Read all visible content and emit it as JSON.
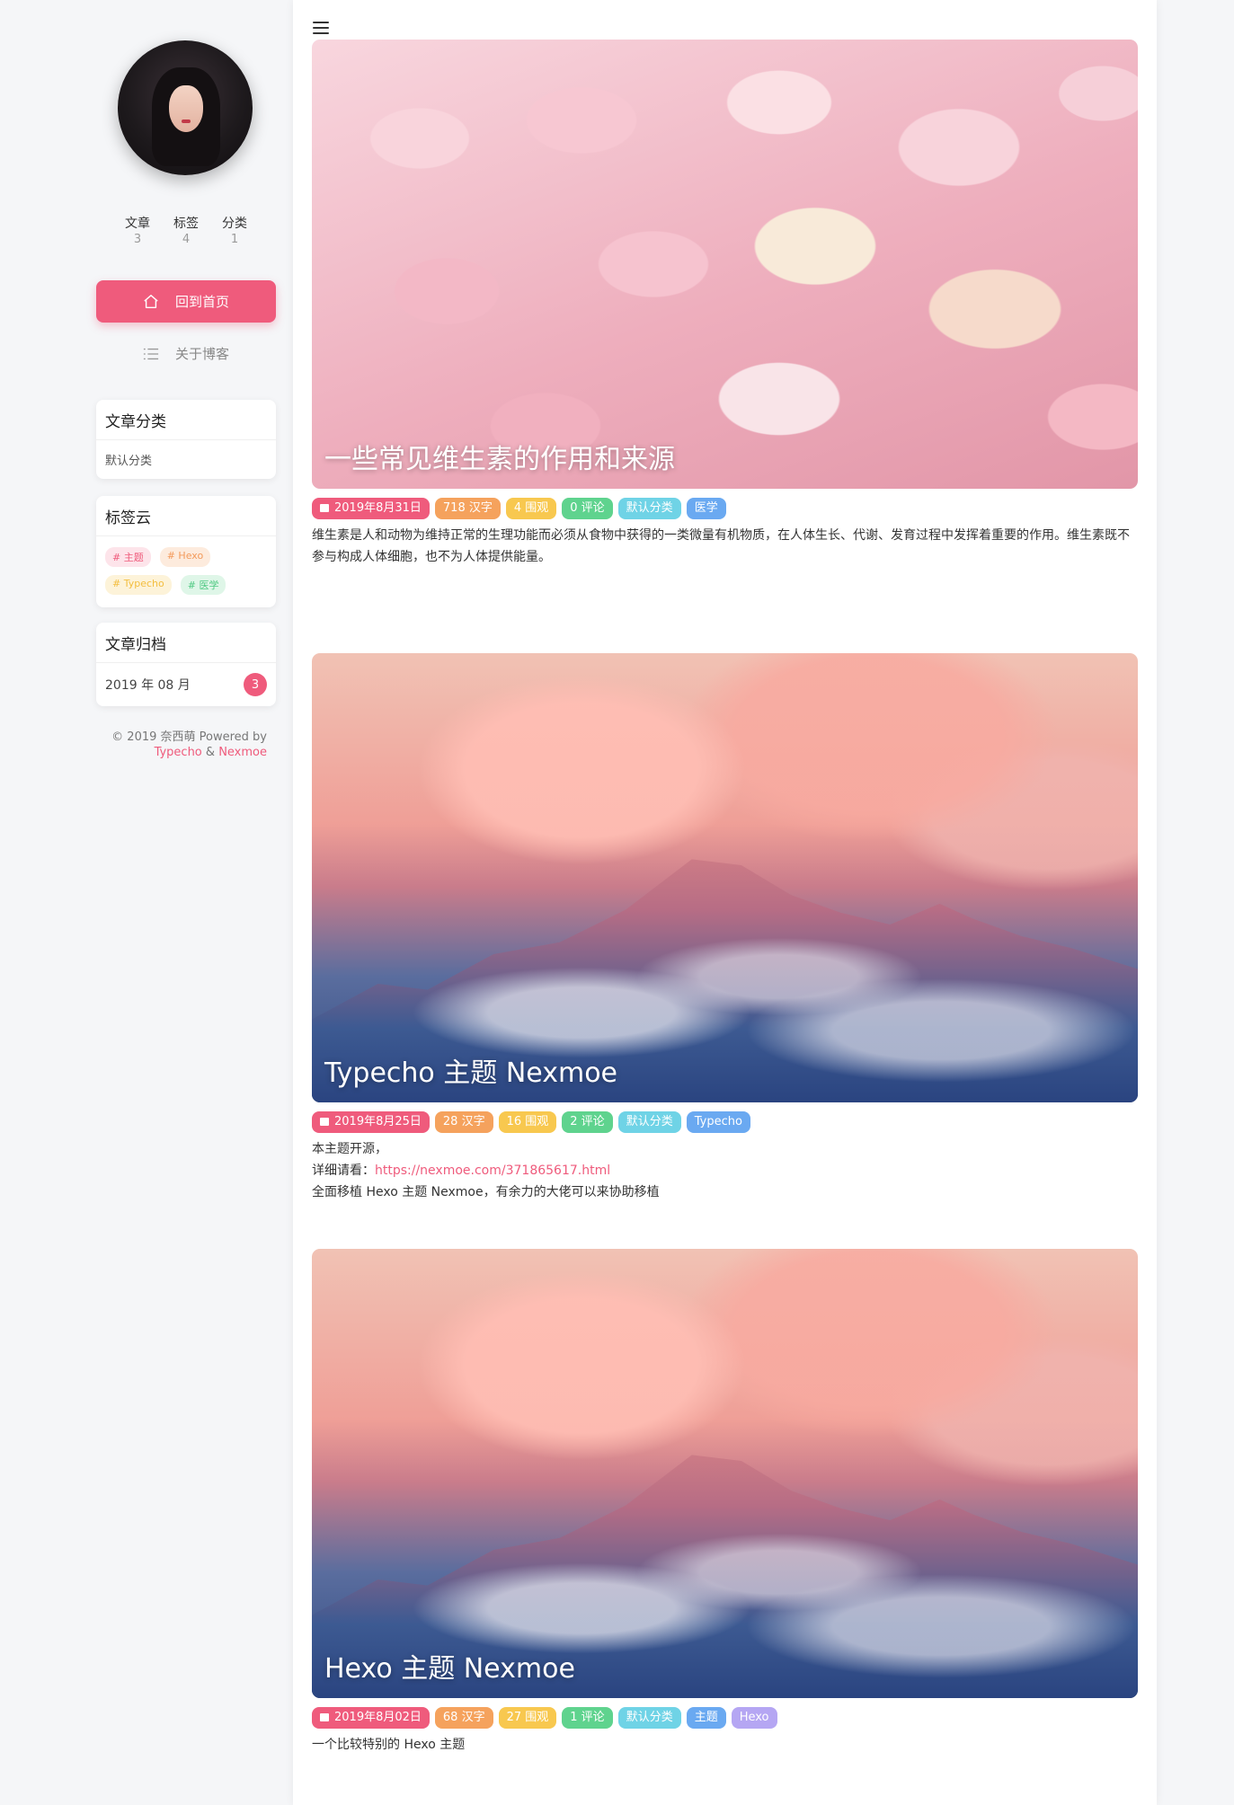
{
  "sidebar": {
    "stats": [
      {
        "label": "文章",
        "value": "3"
      },
      {
        "label": "标签",
        "value": "4"
      },
      {
        "label": "分类",
        "value": "1"
      }
    ],
    "nav": {
      "home": "回到首页",
      "about": "关于博客"
    },
    "categories": {
      "title": "文章分类",
      "items": [
        "默认分类"
      ]
    },
    "tags": {
      "title": "标签云",
      "items": [
        "# 主题",
        "# Hexo",
        "# Typecho",
        "# 医学"
      ]
    },
    "archive": {
      "title": "文章归档",
      "month": "2019 年 08 月",
      "count": "3"
    },
    "footer": {
      "copyright": "© 2019 奈西萌 Powered by",
      "typecho": "Typecho",
      "amp": "&",
      "nexmoe": "Nexmoe"
    }
  },
  "posts": [
    {
      "title": "一些常见维生素的作用和来源",
      "date": "2019年8月31日",
      "words": "718 汉字",
      "views": "4 围观",
      "comments": "0 评论",
      "category": "默认分类",
      "tags": [
        "医学"
      ],
      "excerpt": "维生素是人和动物为维持正常的生理功能而必须从食物中获得的一类微量有机物质，在人体生长、代谢、发育过程中发挥着重要的作用。维生素既不参与构成人体细胞，也不为人体提供能量。"
    },
    {
      "title": "Typecho 主题 Nexmoe",
      "date": "2019年8月25日",
      "words": "28 汉字",
      "views": "16 围观",
      "comments": "2 评论",
      "category": "默认分类",
      "tags": [
        "Typecho"
      ],
      "excerpt_line1": "本主题开源，",
      "excerpt_line2_label": "详细请看：",
      "excerpt_line2_link": "https://nexmoe.com/371865617.html",
      "excerpt_line3": "全面移植 Hexo 主题 Nexmoe，有余力的大佬可以来协助移植"
    },
    {
      "title": "Hexo 主题 Nexmoe",
      "date": "2019年8月02日",
      "words": "68 汉字",
      "views": "27 围观",
      "comments": "1 评论",
      "category": "默认分类",
      "tags": [
        "主题",
        "Hexo"
      ],
      "excerpt": "一个比较特别的 Hexo 主题"
    }
  ],
  "colors": {
    "accent": "#ef5b7c",
    "orange": "#f5a25d",
    "yellow": "#f8c84f",
    "green": "#5fd38e",
    "cyan": "#6fd3e6",
    "blue": "#6aa9f1",
    "purple": "#b5a6f3"
  },
  "icons": {
    "menu": "menu-icon",
    "home": "home-icon",
    "list": "list-icon",
    "calendar": "calendar-icon"
  }
}
